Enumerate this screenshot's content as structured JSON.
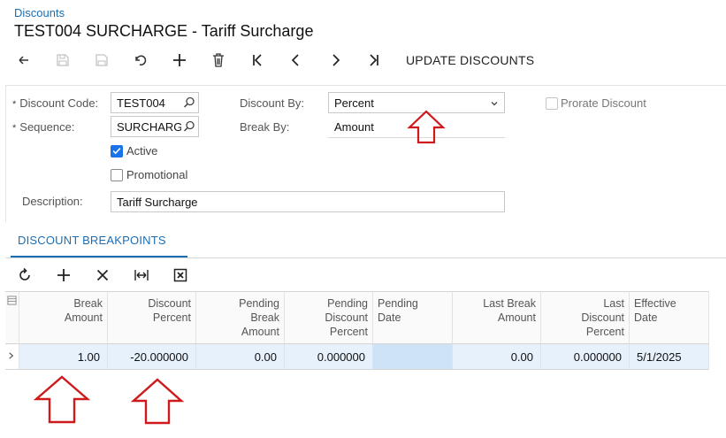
{
  "breadcrumb": "Discounts",
  "title": "TEST004 SURCHARGE - Tariff Surcharge",
  "toolbar": {
    "update_discounts": "UPDATE DISCOUNTS",
    "icons": [
      "back-icon",
      "save-icon",
      "save-close-icon",
      "undo-icon",
      "add-icon",
      "delete-icon",
      "first-icon",
      "previous-icon",
      "next-icon",
      "last-icon"
    ]
  },
  "form": {
    "discount_code_label": "Discount Code:",
    "discount_code_value": "TEST004",
    "sequence_label": "Sequence:",
    "sequence_value": "SURCHARGE",
    "active_label": "Active",
    "active_checked": true,
    "promotional_label": "Promotional",
    "promotional_checked": false,
    "description_label": "Description:",
    "description_value": "Tariff Surcharge",
    "discount_by_label": "Discount By:",
    "discount_by_value": "Percent",
    "break_by_label": "Break By:",
    "break_by_value": "Amount",
    "prorate_label": "Prorate Discount",
    "prorate_checked": false,
    "required_marker": "*"
  },
  "tabs": [
    {
      "label": "DISCOUNT BREAKPOINTS",
      "active": true
    }
  ],
  "grid": {
    "columns": [
      {
        "label": "Break Amount",
        "lines": [
          "Break",
          "Amount"
        ]
      },
      {
        "label": "Discount Percent",
        "lines": [
          "Discount",
          "Percent"
        ]
      },
      {
        "label": "Pending Break Amount",
        "lines": [
          "Pending",
          "Break",
          "Amount"
        ]
      },
      {
        "label": "Pending Discount Percent",
        "lines": [
          "Pending",
          "Discount",
          "Percent"
        ]
      },
      {
        "label": "Pending Date",
        "lines": [
          "Pending",
          "Date"
        ]
      },
      {
        "label": "Last Break Amount",
        "lines": [
          "Last Break",
          "Amount"
        ]
      },
      {
        "label": "Last Discount Percent",
        "lines": [
          "Last",
          "Discount",
          "Percent"
        ]
      },
      {
        "label": "Effective Date",
        "lines": [
          "Effective",
          "Date"
        ]
      }
    ],
    "rows": [
      [
        "1.00",
        "-20.000000",
        "0.00",
        "0.000000",
        "",
        "0.00",
        "0.000000",
        "5/1/2025"
      ]
    ]
  },
  "colors": {
    "accent": "#1a6fb4",
    "arrow": "#d0191c",
    "selected_row": "#e6f1fb",
    "checkbox": "#1a73e8"
  }
}
